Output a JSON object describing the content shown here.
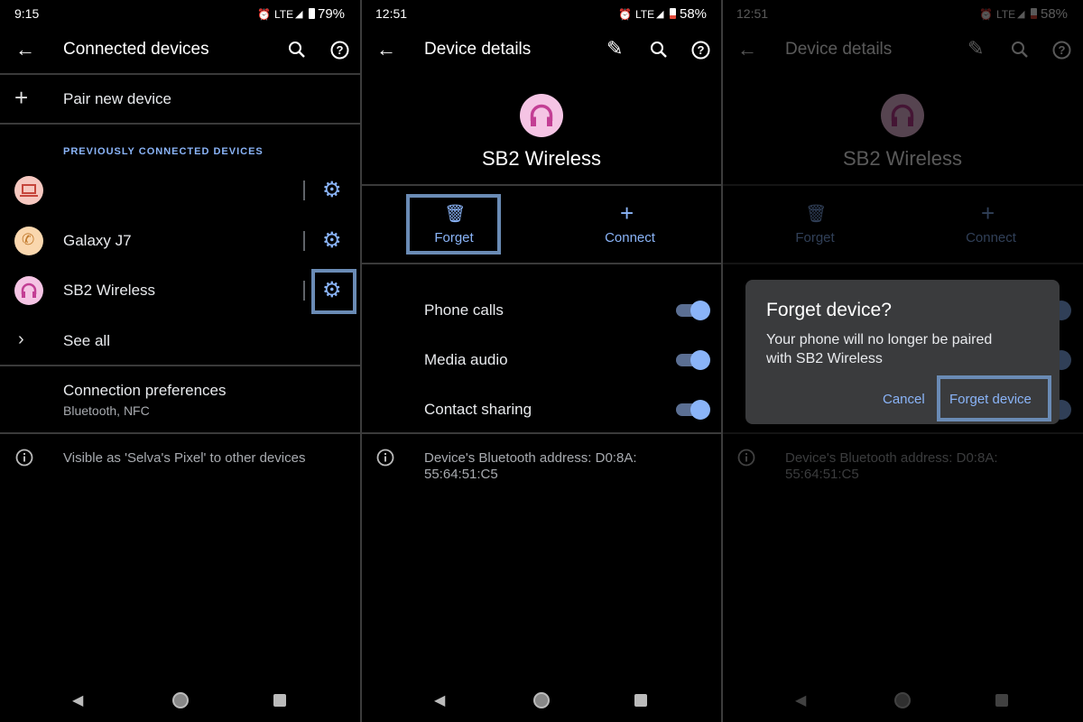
{
  "panel1": {
    "status": {
      "time": "9:15",
      "network": "LTE",
      "battery": "79%"
    },
    "title": "Connected devices",
    "pair_new": "Pair new device",
    "section_header": "PREVIOUSLY CONNECTED DEVICES",
    "devices": [
      {
        "name": "",
        "icon": "laptop-icon",
        "color": "#f6c8c0"
      },
      {
        "name": "Galaxy J7",
        "icon": "phone-icon",
        "color": "#fad7ae"
      },
      {
        "name": "SB2 Wireless",
        "icon": "headset-icon",
        "color": "#f5c4e4"
      }
    ],
    "see_all": "See all",
    "connection_prefs": {
      "title": "Connection preferences",
      "subtitle": "Bluetooth, NFC"
    },
    "visible_as": "Visible as 'Selva's Pixel' to other devices"
  },
  "panel2": {
    "status": {
      "time": "12:51",
      "network": "LTE",
      "battery": "58%"
    },
    "title": "Device details",
    "device_name": "SB2 Wireless",
    "actions": {
      "forget": "Forget",
      "connect": "Connect"
    },
    "toggles": [
      {
        "label": "Phone calls",
        "on": true
      },
      {
        "label": "Media audio",
        "on": true
      },
      {
        "label": "Contact sharing",
        "on": true
      }
    ],
    "address_line1": "Device's Bluetooth address: D0:8A:",
    "address_line2": "55:64:51:C5"
  },
  "dialog": {
    "title": "Forget device?",
    "message_line1": "Your phone will no longer be paired",
    "message_line2": "with SB2 Wireless",
    "cancel": "Cancel",
    "confirm": "Forget device"
  },
  "colors": {
    "accent": "#8ab4f8",
    "highlight": "#6a8bb5",
    "dialog_bg": "#3a3b3d"
  }
}
